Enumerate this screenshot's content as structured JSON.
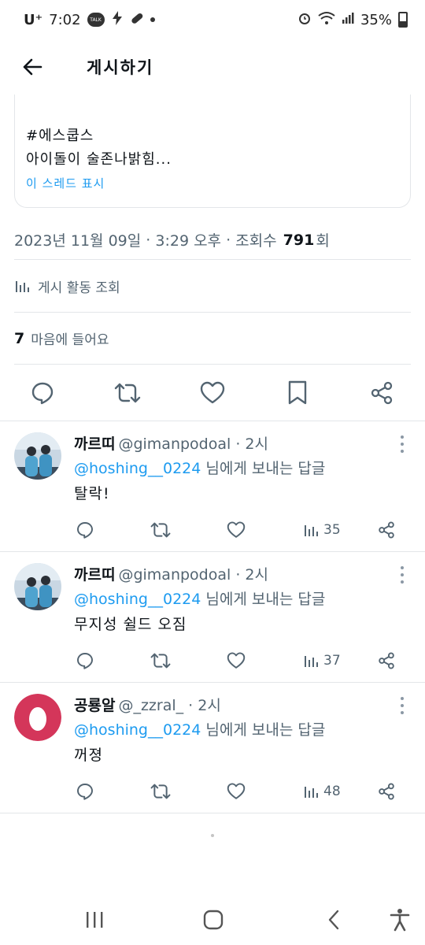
{
  "status_bar": {
    "carrier": "U⁺",
    "time": "7:02",
    "talk_badge": "TALK",
    "battery": "35%",
    "icons": [
      "kakaotalk-icon",
      "bolt-icon",
      "pill-icon",
      "alarm-icon",
      "wifi-icon",
      "signal-icon",
      "battery-icon"
    ]
  },
  "header": {
    "title": "게시하기"
  },
  "quote_card": {
    "line1": "#에스쿱스",
    "line2": "아이돌이 술존나밝힘...",
    "thread_link": "이 스레드 표시"
  },
  "meta": {
    "date": "2023년 11월 09일",
    "sep1": " · ",
    "time": "3:29 오후",
    "sep2": " · ",
    "views_label": "조회수 ",
    "views_count": "791",
    "views_unit": "회"
  },
  "activity": {
    "label": "게시 활동 조회"
  },
  "likes": {
    "count": "7",
    "label": "마음에 들어요"
  },
  "colors": {
    "link": "#1d9bf0",
    "muted": "#536471",
    "text": "#0f1419",
    "egg_avatar": "#d4365a"
  },
  "replies": [
    {
      "name": "까르띠",
      "handle": "@gimanpodoal",
      "time": " · 2시",
      "mention": "@hoshing__0224",
      "reply_suffix": " 님에게 보내는 답글",
      "text": "탈락!",
      "views": "35"
    },
    {
      "name": "까르띠",
      "handle": "@gimanpodoal",
      "time": " · 2시",
      "mention": "@hoshing__0224",
      "reply_suffix": " 님에게 보내는 답글",
      "text": "무지성 쉴드 오짐",
      "views": "37"
    },
    {
      "name": "공룡알",
      "handle": "@_zzral_",
      "time": " · 2시",
      "mention": "@hoshing__0224",
      "reply_suffix": " 님에게 보내는 답글",
      "text": "꺼졍",
      "views": "48"
    }
  ]
}
